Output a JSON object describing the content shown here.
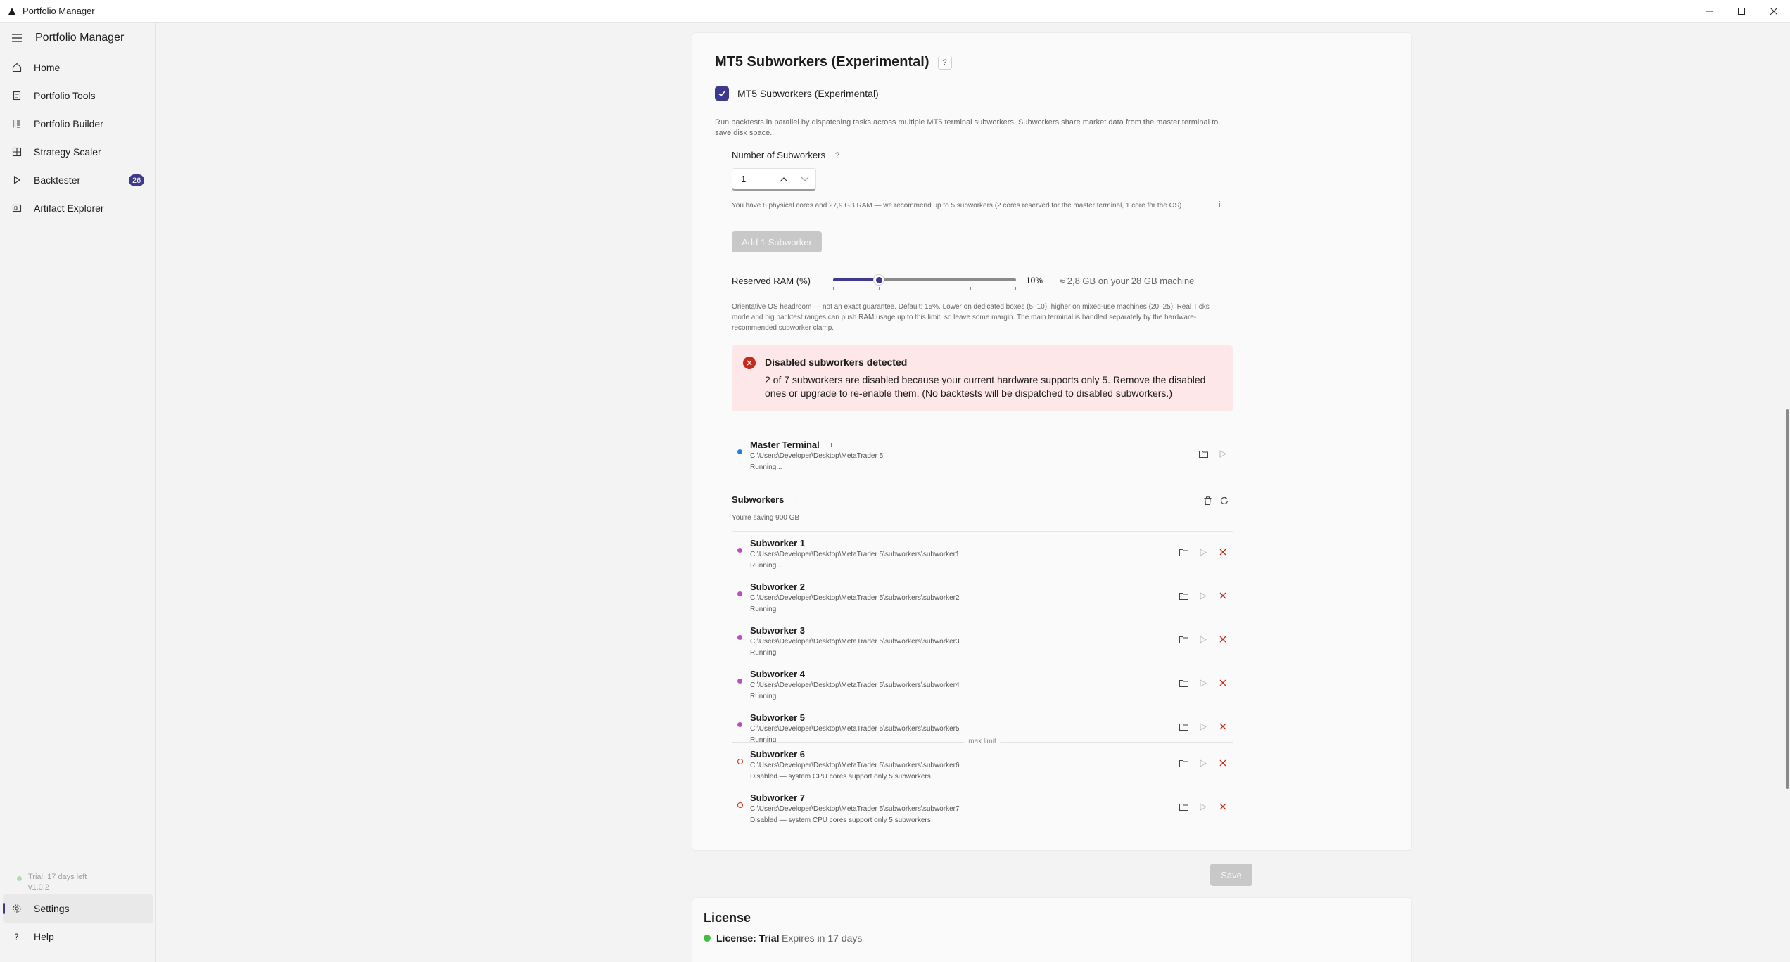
{
  "window": {
    "title": "Portfolio Manager"
  },
  "sidebar": {
    "app_name": "Portfolio Manager",
    "items": [
      {
        "label": "Home",
        "icon": "home-icon"
      },
      {
        "label": "Portfolio Tools",
        "icon": "document-icon"
      },
      {
        "label": "Portfolio Builder",
        "icon": "builder-icon"
      },
      {
        "label": "Strategy Scaler",
        "icon": "grid-icon"
      },
      {
        "label": "Backtester",
        "icon": "play-icon",
        "badge": "26"
      },
      {
        "label": "Artifact Explorer",
        "icon": "explorer-icon"
      }
    ],
    "trial_text": "Trial: 17 days left",
    "version": "v1.0.2",
    "settings_label": "Settings",
    "help_label": "Help"
  },
  "subworkers_section": {
    "title": "MT5 Subworkers (Experimental)",
    "help": "?",
    "checkbox_label": "MT5 Subworkers (Experimental)",
    "checkbox_checked": true,
    "description": "Run backtests in parallel by dispatching tasks across multiple MT5 terminal subworkers. Subworkers share market data from the master terminal to save disk space.",
    "num_label": "Number of Subworkers",
    "num_value": "1",
    "hardware_note": "You have 8 physical cores and 27,9 GB RAM — we recommend up to 5 subworkers (2 cores reserved for the master terminal, 1 core for the OS)",
    "hardware_help": "i",
    "add_button": "Add 1 Subworker",
    "ram_label": "Reserved RAM (%)",
    "ram_value": 10,
    "ram_percent_text": "10%",
    "ram_memory_text": "≈ 2,8 GB on your 28 GB machine",
    "ram_note": "Orientative OS headroom — not an exact guarantee. Default: 15%. Lower on dedicated boxes (5–10), higher on mixed-use machines (20–25). Real Ticks mode and big backtest ranges can push RAM usage up to this limit, so leave some margin. The main terminal is handled separately by the hardware-recommended subworker clamp.",
    "alert": {
      "title": "Disabled subworkers detected",
      "message": "2 of 7 subworkers are disabled because your current hardware supports only 5. Remove the disabled ones or upgrade to re-enable them. (No backtests will be dispatched to disabled subworkers.)"
    },
    "master": {
      "name": "Master Terminal",
      "help": "i",
      "path": "C:\\Users\\Developer\\Desktop\\MetaTrader 5",
      "status": "Running..."
    },
    "subworkers_label": "Subworkers",
    "subworkers_help": "i",
    "saving_text": "You're saving 900 GB",
    "max_limit_text": "max limit",
    "subworkers": [
      {
        "name": "Subworker 1",
        "path": "C:\\Users\\Developer\\Desktop\\MetaTrader 5\\subworkers\\subworker1",
        "status": "Running...",
        "state": "running"
      },
      {
        "name": "Subworker 2",
        "path": "C:\\Users\\Developer\\Desktop\\MetaTrader 5\\subworkers\\subworker2",
        "status": "Running",
        "state": "running"
      },
      {
        "name": "Subworker 3",
        "path": "C:\\Users\\Developer\\Desktop\\MetaTrader 5\\subworkers\\subworker3",
        "status": "Running",
        "state": "running"
      },
      {
        "name": "Subworker 4",
        "path": "C:\\Users\\Developer\\Desktop\\MetaTrader 5\\subworkers\\subworker4",
        "status": "Running",
        "state": "running"
      },
      {
        "name": "Subworker 5",
        "path": "C:\\Users\\Developer\\Desktop\\MetaTrader 5\\subworkers\\subworker5",
        "status": "Running",
        "state": "running"
      },
      {
        "name": "Subworker 6",
        "path": "C:\\Users\\Developer\\Desktop\\MetaTrader 5\\subworkers\\subworker6",
        "status": "Disabled — system CPU cores support only 5 subworkers",
        "state": "disabled"
      },
      {
        "name": "Subworker 7",
        "path": "C:\\Users\\Developer\\Desktop\\MetaTrader 5\\subworkers\\subworker7",
        "status": "Disabled — system CPU cores support only 5 subworkers",
        "state": "disabled"
      }
    ],
    "save_button": "Save"
  },
  "license": {
    "title": "License",
    "label": "License: Trial",
    "expiry": "Expires in 17 days"
  },
  "colors": {
    "accent": "#3d3a8c",
    "error": "#c42b1c",
    "alert_bg": "#fde7e9",
    "running_dot": "#b94ec0",
    "master_dot": "#2a7fd4",
    "license_dot": "#3fbf3f"
  }
}
